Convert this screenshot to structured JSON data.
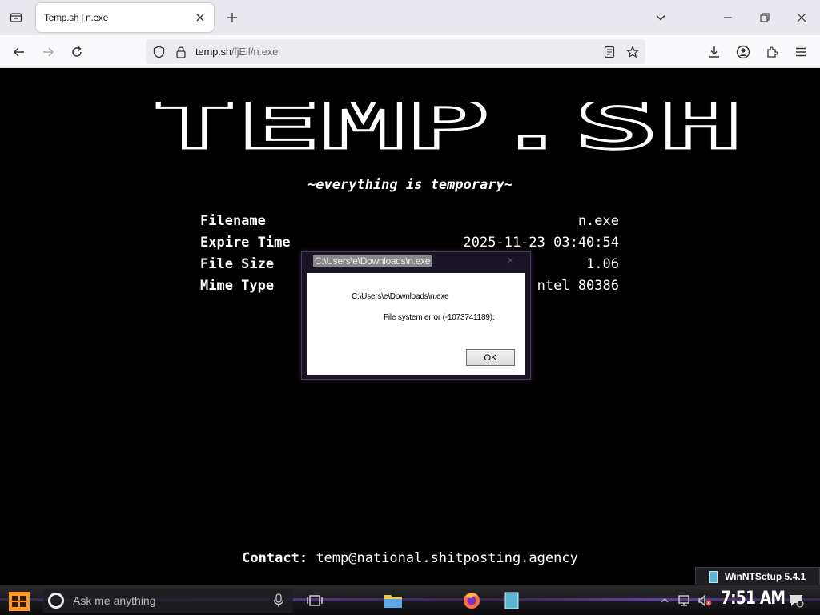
{
  "browser": {
    "tab_title": "Temp.sh | n.exe",
    "url_host": "temp.sh",
    "url_path": "/fjEif/n.exe"
  },
  "page": {
    "logo_text": "TEMP.SH",
    "tagline": "~everything is temporary~",
    "info": [
      {
        "key": "Filename",
        "value": "n.exe"
      },
      {
        "key": "Expire Time",
        "value": "2025-11-23 03:40:54"
      },
      {
        "key": "File Size",
        "value": "1.06"
      },
      {
        "key": "Mime Type",
        "value": "ntel 80386"
      }
    ],
    "contact_label": "Contact:",
    "contact_email": "temp@national.shitposting.agency"
  },
  "dialog": {
    "title": "C:\\Users\\e\\Downloads\\n.exe",
    "path": "C:\\Users\\e\\Downloads\\n.exe",
    "message": "File system error (-1073741189).",
    "ok_label": "OK"
  },
  "notification": {
    "label": "WinNTSetup 5.4.1"
  },
  "taskbar": {
    "search_placeholder": "Ask me anything",
    "clock": "7:51 AM"
  },
  "colors": {
    "page_bg": "#000000",
    "text": "#ffffff",
    "accent": "#6b3fa8"
  }
}
